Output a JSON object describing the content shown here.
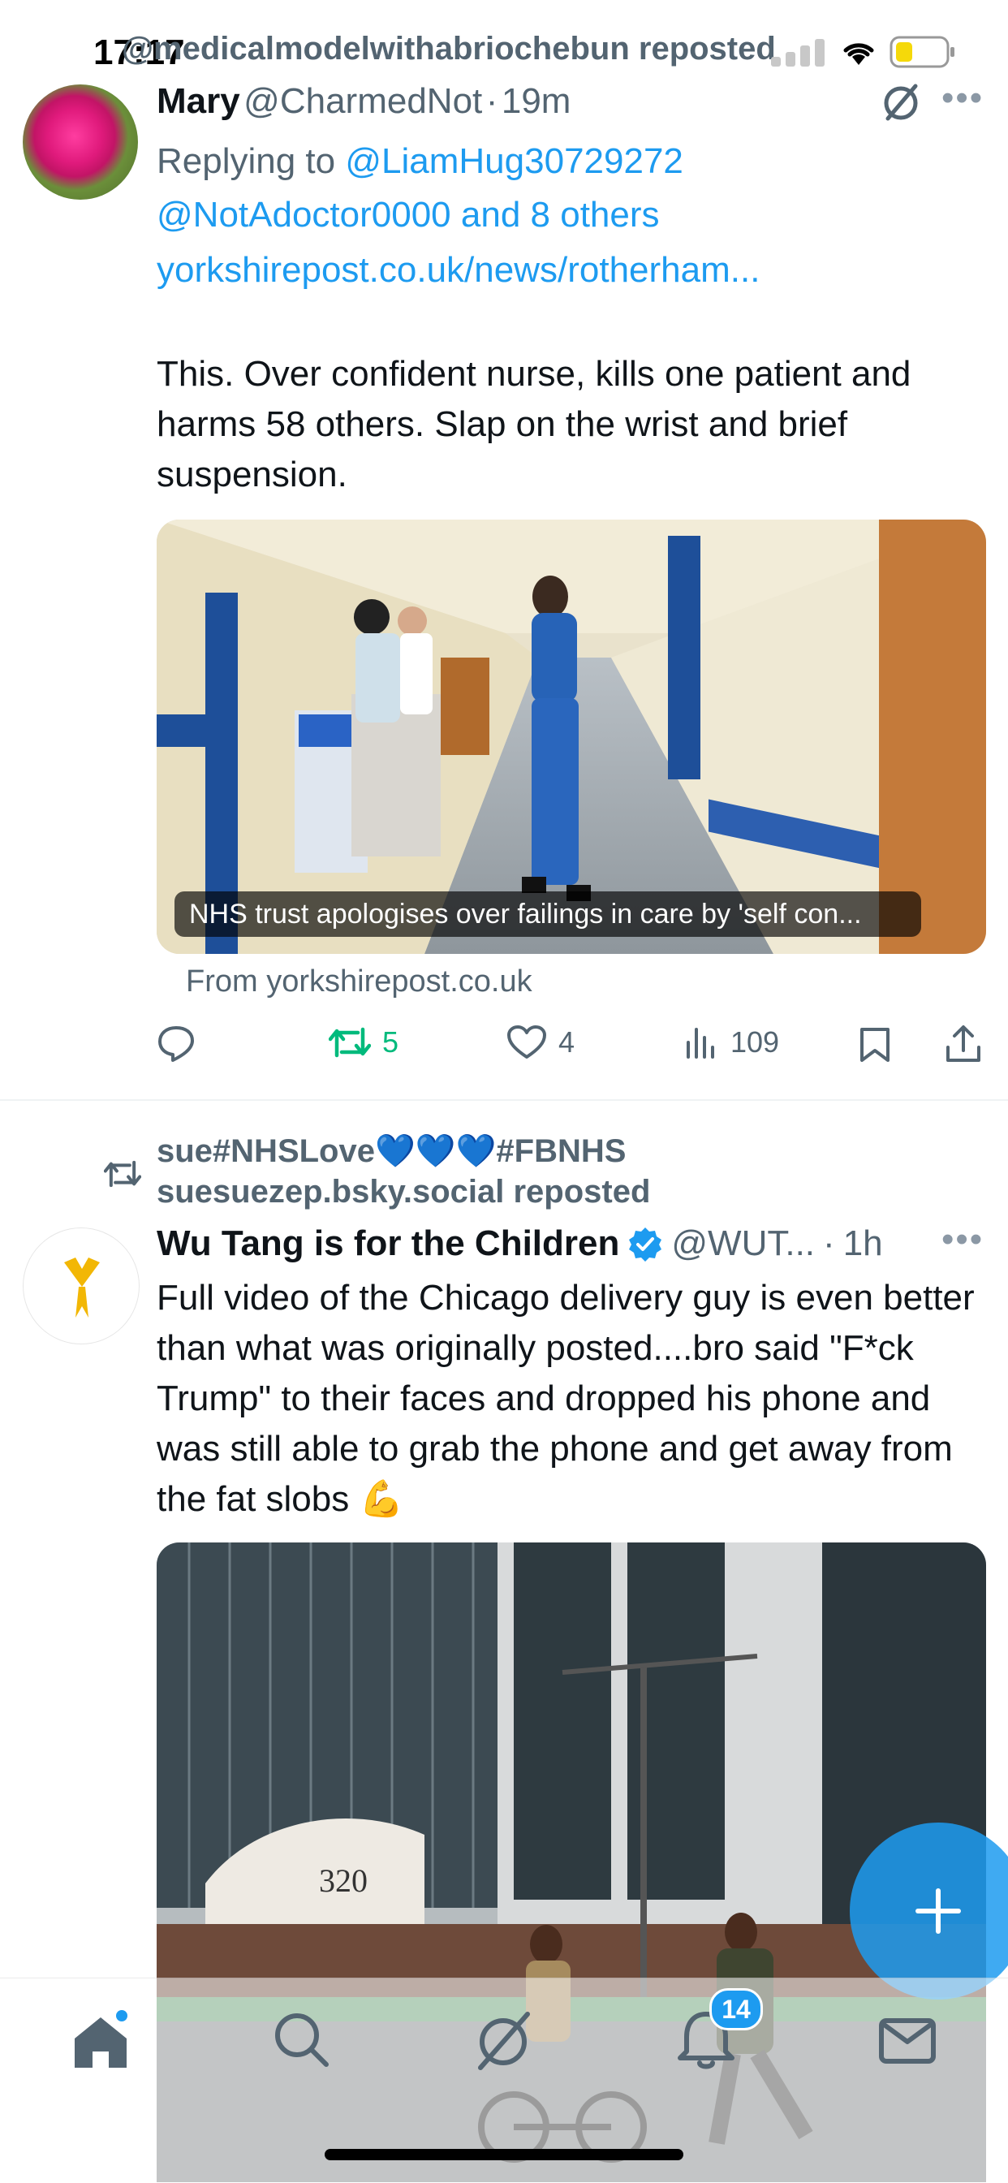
{
  "status_bar": {
    "time": "17:17"
  },
  "top_repost_banner": "@medicalmodelwithabriochebun reposted",
  "tweet1": {
    "name": "Mary",
    "handle": "@CharmedNot",
    "separator": "·",
    "time": "19m",
    "replying_prefix": "Replying to",
    "reply_user1": "@LiamHug30729272",
    "reply_user2": "@NotAdoctor0000",
    "reply_others": "and 8 others",
    "link": "yorkshirepost.co.uk/news/rotherham...",
    "text": "This. Over confident nurse, kills one patient and harms 58 others.  Slap on the wrist and brief suspension.",
    "card_caption": "NHS trust apologises over failings in care by 'self con...",
    "card_source": "From yorkshirepost.co.uk",
    "reposts": "5",
    "likes": "4",
    "views": "109"
  },
  "tweet2": {
    "repost_line1": "sue#NHSLove💙💙💙#FBNHS",
    "repost_line2": "suesuezep.bsky.social reposted",
    "name": "Wu Tang is for the Children",
    "handle": "@WUT...",
    "separator": "·",
    "time": "1h",
    "text": "Full video of the Chicago delivery guy is even better than what was originally posted....bro said \"F*ck Trump\" to their faces and dropped his phone and was still able to grab the phone and get away from the fat slobs 💪",
    "building_number": "320"
  },
  "bottom_nav": {
    "notifications_badge": "14"
  },
  "colors": {
    "accent": "#1d9bf0",
    "repost_green": "#00ba7c",
    "muted": "#536471",
    "verified": "#1d9bf0"
  },
  "icons": {
    "more": "more-horizontal-icon",
    "grok": "grok-icon",
    "reply": "reply-icon",
    "repost": "repost-icon",
    "like": "heart-icon",
    "views": "views-icon",
    "bookmark": "bookmark-icon",
    "share": "share-icon"
  }
}
